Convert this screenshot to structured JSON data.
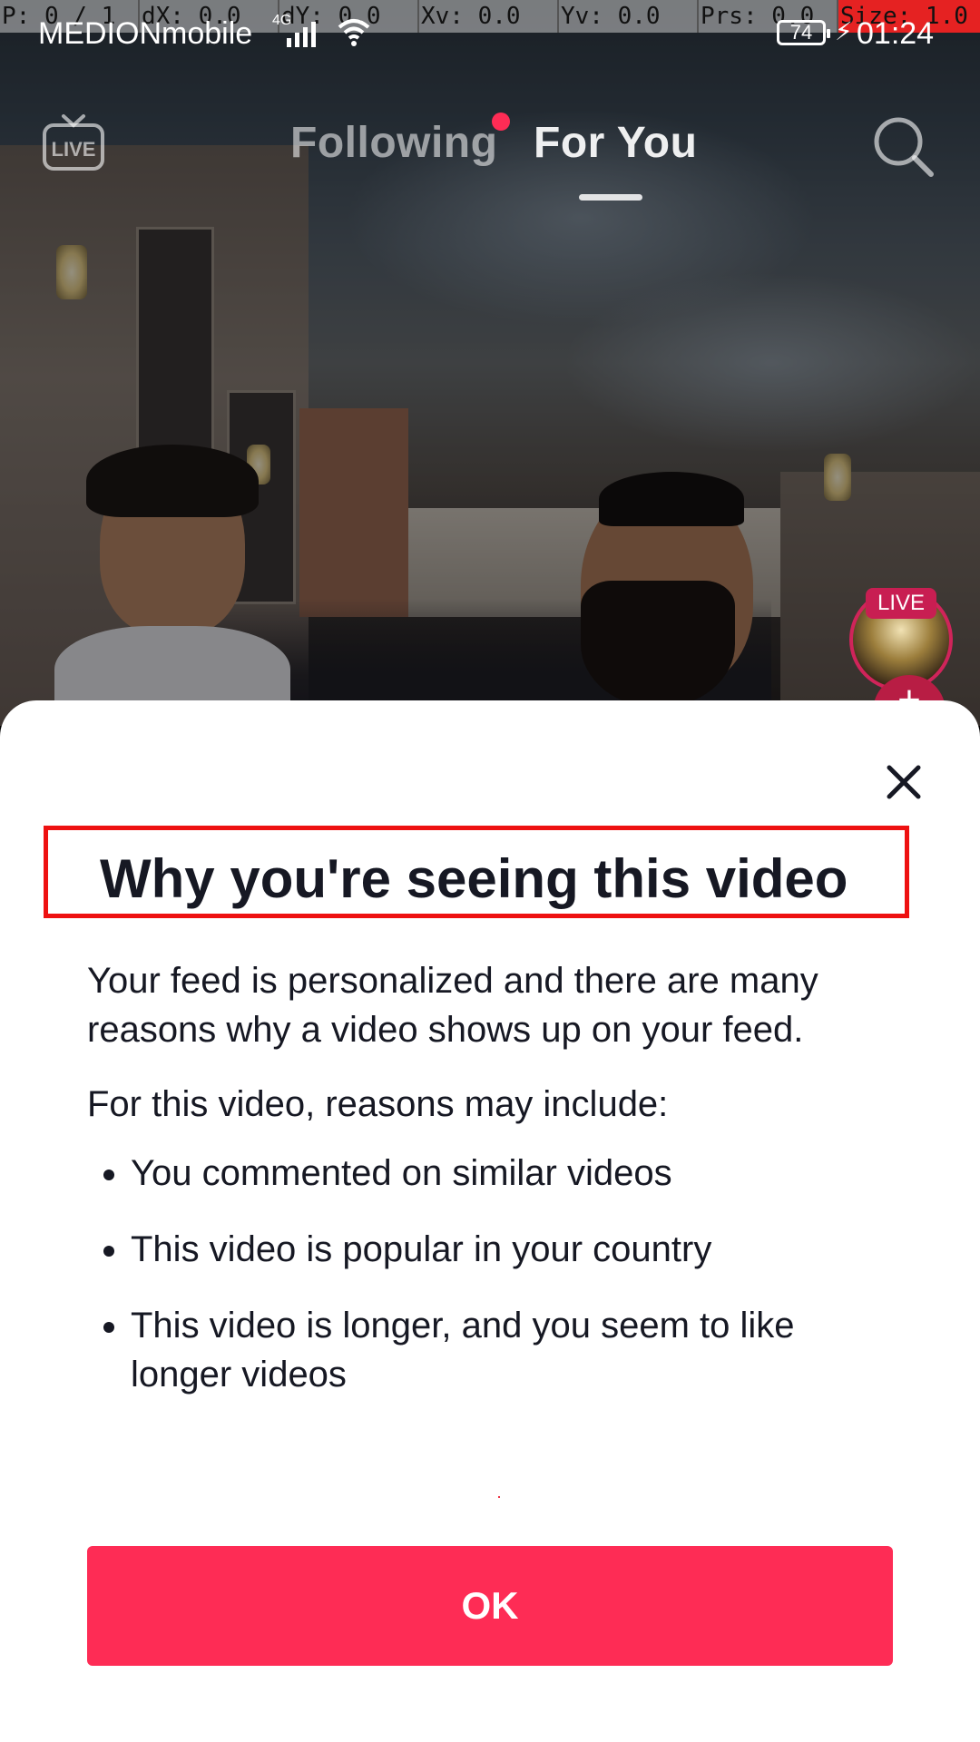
{
  "debug_overlay": {
    "pointer": "P: 0 / 1",
    "dx": "dX: 0.0",
    "dy": "dY: 0.0",
    "xv": "Xv: 0.0",
    "yv": "Yv: 0.0",
    "prs": "Prs: 0.0",
    "size": "Size: 1.0"
  },
  "status_bar": {
    "carrier": "MEDIONmobile",
    "network_type": "4G",
    "battery_level": "74",
    "time": "01:24"
  },
  "top_nav": {
    "live_icon_label": "LIVE",
    "tabs": [
      {
        "label": "Following",
        "has_notification_dot": true,
        "active": false
      },
      {
        "label": "For You",
        "active": true
      }
    ]
  },
  "live_avatar": {
    "badge": "LIVE",
    "plus": "+"
  },
  "sheet": {
    "title": "Why you're seeing this video",
    "intro": "Your feed is personalized and there are many reasons why a video shows up on your feed.",
    "reasons_heading": "For this video, reasons may include:",
    "reasons": [
      "You commented on similar videos",
      "This video is popular in your country",
      "This video is longer, and you seem to like longer videos"
    ],
    "ok_label": "OK"
  },
  "colors": {
    "accent": "#fe2c55",
    "title_highlight_border": "#ee1111",
    "text_primary": "#161823"
  },
  "icons": [
    "live-tv-icon",
    "search-icon",
    "close-icon",
    "signal-icon",
    "wifi-icon",
    "battery-icon",
    "charging-icon"
  ]
}
